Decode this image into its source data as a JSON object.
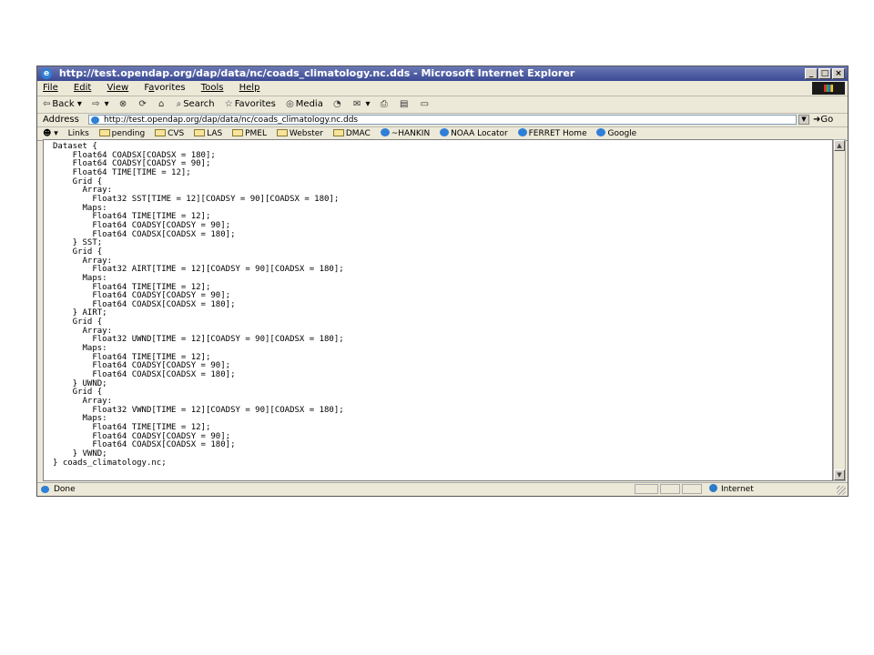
{
  "window": {
    "title": "http://test.opendap.org/dap/data/nc/coads_climatology.nc.dds - Microsoft Internet Explorer",
    "controls": {
      "minimize": "_",
      "maximize": "□",
      "close": "×"
    }
  },
  "menubar": {
    "items": [
      {
        "label": "File",
        "hotkey_index": 0
      },
      {
        "label": "Edit",
        "hotkey_index": 0
      },
      {
        "label": "View",
        "hotkey_index": 0
      },
      {
        "label": "Favorites",
        "hotkey_index": 1
      },
      {
        "label": "Tools",
        "hotkey_index": 0
      },
      {
        "label": "Help",
        "hotkey_index": 0
      }
    ]
  },
  "toolbar": {
    "back_label": "Back",
    "search_label": "Search",
    "favorites_label": "Favorites",
    "media_label": "Media"
  },
  "address": {
    "label": "Address",
    "value": "http://test.opendap.org/dap/data/nc/coads_climatology.nc.dds",
    "go_label": "Go"
  },
  "links": {
    "label": "Links",
    "items": [
      {
        "label": "pending",
        "icon": "folder-icon"
      },
      {
        "label": "CVS",
        "icon": "folder-icon"
      },
      {
        "label": "LAS",
        "icon": "folder-icon"
      },
      {
        "label": "PMEL",
        "icon": "folder-icon"
      },
      {
        "label": "Webster",
        "icon": "folder-icon"
      },
      {
        "label": "DMAC",
        "icon": "folder-icon"
      },
      {
        "label": "~HANKIN",
        "icon": "page-icon"
      },
      {
        "label": "NOAA Locator",
        "icon": "page-icon"
      },
      {
        "label": "FERRET Home",
        "icon": "page-icon"
      },
      {
        "label": "Google",
        "icon": "page-icon"
      }
    ]
  },
  "document": {
    "lines": [
      "Dataset {",
      "    Float64 COADSX[COADSX = 180];",
      "    Float64 COADSY[COADSY = 90];",
      "    Float64 TIME[TIME = 12];",
      "    Grid {",
      "      Array:",
      "        Float32 SST[TIME = 12][COADSY = 90][COADSX = 180];",
      "      Maps:",
      "        Float64 TIME[TIME = 12];",
      "        Float64 COADSY[COADSY = 90];",
      "        Float64 COADSX[COADSX = 180];",
      "    } SST;",
      "    Grid {",
      "      Array:",
      "        Float32 AIRT[TIME = 12][COADSY = 90][COADSX = 180];",
      "      Maps:",
      "        Float64 TIME[TIME = 12];",
      "        Float64 COADSY[COADSY = 90];",
      "        Float64 COADSX[COADSX = 180];",
      "    } AIRT;",
      "    Grid {",
      "      Array:",
      "        Float32 UWND[TIME = 12][COADSY = 90][COADSX = 180];",
      "      Maps:",
      "        Float64 TIME[TIME = 12];",
      "        Float64 COADSY[COADSY = 90];",
      "        Float64 COADSX[COADSX = 180];",
      "    } UWND;",
      "    Grid {",
      "      Array:",
      "        Float32 VWND[TIME = 12][COADSY = 90][COADSX = 180];",
      "      Maps:",
      "        Float64 TIME[TIME = 12];",
      "        Float64 COADSY[COADSY = 90];",
      "        Float64 COADSX[COADSX = 180];",
      "    } VWND;",
      "} coads_climatology.nc;"
    ]
  },
  "status": {
    "text": "Done",
    "zone": "Internet"
  }
}
